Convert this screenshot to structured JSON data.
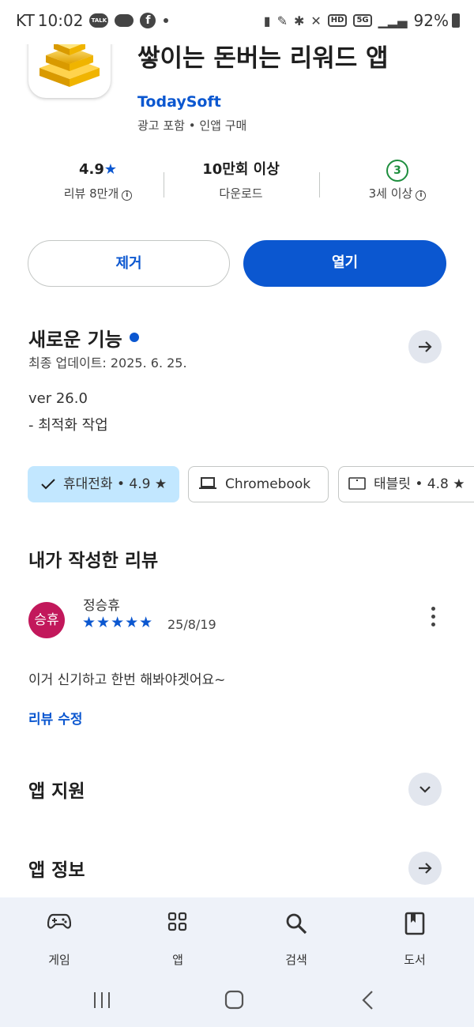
{
  "status_bar": {
    "carrier": "KT",
    "time": "10:02",
    "talk_badge": "TALK",
    "facebook_glyph": "f",
    "hd_badge": "HD",
    "network": "5G",
    "battery": "92%"
  },
  "app": {
    "icon": "gold-bars-icon",
    "title": "금캐기 - 기만히 있어도 금이 쌓이는 돈버는 리워드 앱",
    "developer": "TodaySoft",
    "meta": "광고 포함 • 인앱 구매"
  },
  "stats": {
    "rating_value": "4.9",
    "rating_star": "★",
    "reviews_label": "리뷰 8만개",
    "downloads_value": "10만회 이상",
    "downloads_label": "다운로드",
    "age_value": "3",
    "age_label": "3세 이상",
    "info_glyph": "i"
  },
  "actions": {
    "remove_label": "제거",
    "open_label": "열기"
  },
  "whats_new": {
    "title": "새로운 기능",
    "updated": "최종 업데이트: 2025. 6. 25.",
    "version": "ver 26.0",
    "notes": "- 최적화 작업"
  },
  "device_chips": [
    {
      "label": "휴대전화 • 4.9 ★",
      "selected": true
    },
    {
      "label": "Chromebook",
      "selected": false
    },
    {
      "label": "태블릿 • 4.8 ★",
      "selected": false
    }
  ],
  "my_review": {
    "section_title": "내가 작성한 리뷰",
    "avatar_text": "승휴",
    "reviewer": "정승휴",
    "rating": 5,
    "stars": "★★★★★",
    "date": "25/8/19",
    "text": "이거 신기하고 한번 해봐야겟어요~",
    "edit_label": "리뷰 수정"
  },
  "sections": {
    "app_support": "앱 지원",
    "app_info": "앱 정보"
  },
  "bottom_nav": [
    {
      "label": "게임",
      "icon": "gamepad-icon"
    },
    {
      "label": "앱",
      "icon": "apps-grid-icon"
    },
    {
      "label": "검색",
      "icon": "search-icon"
    },
    {
      "label": "도서",
      "icon": "book-icon"
    }
  ],
  "colors": {
    "accent": "#0b57d0",
    "selected_chip": "#c2e7ff",
    "age_green": "#1e8e3e",
    "avatar": "#c2185b",
    "nav_background": "#eef2f9"
  }
}
